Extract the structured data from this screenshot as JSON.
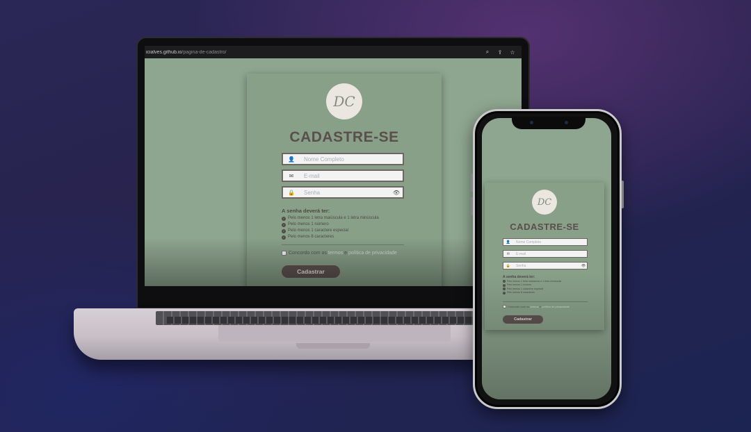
{
  "browser": {
    "url_host": "icialves.github.io",
    "url_path": "/pagina-de-cadastro/",
    "icons": [
      "zoom-icon",
      "share-icon",
      "star-icon"
    ],
    "zoom_glyph": "⌕",
    "share_glyph": "⇪",
    "star_glyph": "☆"
  },
  "form": {
    "logo_text": "DC",
    "title": "CADASTRE-SE",
    "fields": {
      "name_placeholder": "Nome Completo",
      "email_placeholder": "E-mail",
      "password_placeholder": "Senha"
    },
    "icons": {
      "user_glyph": "👤",
      "mail_glyph": "✉",
      "lock_glyph": "🔒",
      "eye_glyph": "👁",
      "check_glyph": "✓"
    },
    "requirements": {
      "title": "A senha deverá ter:",
      "items": [
        "Pelo menos 1 letra maiúscula e 1 letra minúscula",
        "Pelo menos 1 número",
        "Pelo menos 1 caractere especial",
        "Pelo menos 8 caracteres"
      ]
    },
    "terms": {
      "prefix": "Concordo com os",
      "terms_link": "termos",
      "conj": "e",
      "privacy_link": "política de privacidade"
    },
    "submit_label": "Cadastrar"
  },
  "colors": {
    "page_bg": "#8ea58f",
    "card_bg": "#889f88",
    "title": "#5a4f4c",
    "button": "#5e5351"
  }
}
